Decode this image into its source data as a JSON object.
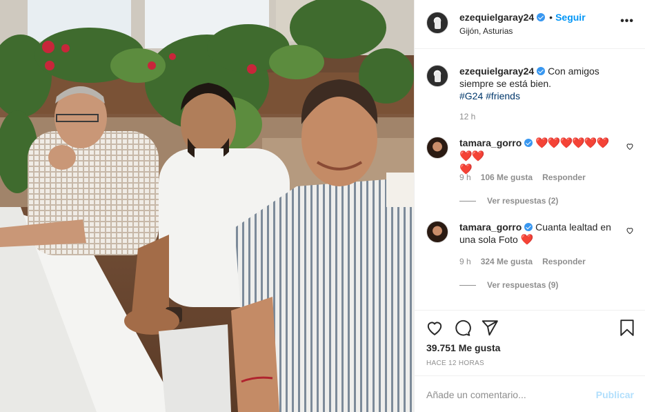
{
  "post": {
    "username": "ezequielgaray24",
    "separator": "•",
    "follow_label": "Seguir",
    "location": "Gijón, Asturias",
    "more_label": "•••"
  },
  "caption": {
    "username": "ezequielgaray24",
    "text": "Con amigos siempre se está bien.",
    "hashtags": [
      "#G24",
      "#friends"
    ],
    "time": "12 h"
  },
  "comments": [
    {
      "username": "tamara_gorro",
      "text": "❤️❤️❤️❤️❤️❤️❤️❤️",
      "text2": "❤️",
      "time": "9 h",
      "likes": "106 Me gusta",
      "reply_label": "Responder",
      "view_replies": "Ver respuestas (2)"
    },
    {
      "username": "tamara_gorro",
      "text": "Cuanta lealtad en una sola Foto",
      "text2": "❤️",
      "time": "9 h",
      "likes": "324 Me gusta",
      "reply_label": "Responder",
      "view_replies": "Ver respuestas (9)"
    }
  ],
  "actions": {
    "likes": "39.751 Me gusta",
    "time_ago": "HACE 12 HORAS"
  },
  "comment_box": {
    "placeholder": "Añade un comentario...",
    "publish_label": "Publicar"
  },
  "colors": {
    "accent": "#0095f6",
    "verified": "#3897f0",
    "heart": "#ed2540",
    "publish_disabled": "#b2dffc"
  },
  "icons": [
    "heart-icon",
    "comment-icon",
    "share-icon",
    "bookmark-icon",
    "more-options-icon",
    "verified-icon"
  ]
}
